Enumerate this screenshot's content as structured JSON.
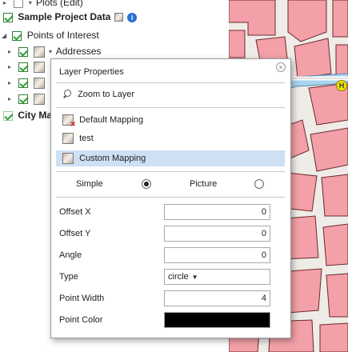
{
  "tree": {
    "rows": [
      {
        "label": "Plots (Edit)"
      },
      {
        "label": "Sample Project Data"
      },
      {
        "label": "Points of Interest"
      },
      {
        "label": "Addresses"
      },
      {
        "label": "City Ma"
      }
    ]
  },
  "popup": {
    "title": "Layer Properties",
    "close_glyph": "×",
    "menu": {
      "zoom": "Zoom to Layer",
      "default_mapping": "Default Mapping",
      "test": "test",
      "custom_mapping": "Custom Mapping"
    },
    "mode": {
      "simple_label": "Simple",
      "picture_label": "Picture",
      "selected": "Simple"
    },
    "props": {
      "offset_x": {
        "label": "Offset X",
        "value": "0"
      },
      "offset_y": {
        "label": "Offset Y",
        "value": "0"
      },
      "angle": {
        "label": "Angle",
        "value": "0"
      },
      "type": {
        "label": "Type",
        "value": "circle"
      },
      "point_width": {
        "label": "Point Width",
        "value": "4"
      },
      "point_color": {
        "label": "Point Color",
        "value": "#000000"
      }
    }
  },
  "map": {
    "building_color": "#f4a0a8",
    "outline_color": "#6a2a2a",
    "water_color": "#a8d4f0",
    "marker_label": "H",
    "marker_color": "#f2e600"
  }
}
